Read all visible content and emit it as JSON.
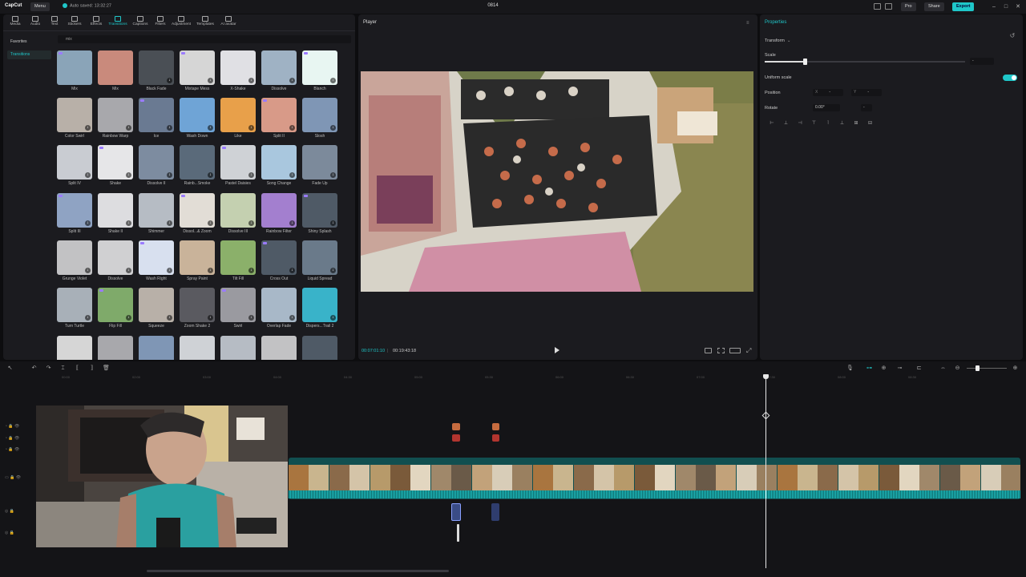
{
  "app": {
    "logo": "CapCut",
    "menu_label": "Menu",
    "autosave": "Auto saved: 13:32:27",
    "project_title": "0814",
    "pro_label": "Pro",
    "share_label": "Share",
    "export_label": "Export"
  },
  "tabs": [
    "Media",
    "Audio",
    "Text",
    "Stickers",
    "Effects",
    "Transitions",
    "Captions",
    "Filters",
    "Adjustment",
    "Templates",
    "AI avatar"
  ],
  "categories": [
    "Favorites",
    "Transitions"
  ],
  "search_value": "mix",
  "transitions": [
    [
      "Mix",
      "Mix",
      "Black Fade",
      "Mixtape Mess",
      "X-Shake",
      "Dissolve",
      "Blanch"
    ],
    [
      "Color Swirl",
      "Rainbow Warp",
      "Ice",
      "Wash Down",
      "Like",
      "Split II",
      "Slosh"
    ],
    [
      "Split IV",
      "Shake",
      "Dissolve II",
      "Rainb...Smoke",
      "Pastel Daisies",
      "Song Change",
      "Fade Up"
    ],
    [
      "Split III",
      "Shake II",
      "Shimmer",
      "Dissol...& Zoom",
      "Dissolve III",
      "Rainbow Filter",
      "Shiny Splash"
    ],
    [
      "Grunge Violet",
      "Dissolve",
      "Wash Right",
      "Spray Paint",
      "Tilt Fill",
      "Cross Out",
      "Liquid Spread"
    ],
    [
      "Turn Turtle",
      "Flip Fill",
      "Squeeze",
      "Zoom Shake 2",
      "Swirl",
      "Overlap Fade",
      "Dispers...Trail 2"
    ]
  ],
  "player": {
    "title": "Player",
    "time_current": "00:07:01:10",
    "time_total": "00:19:43:18"
  },
  "properties": {
    "title": "Properties",
    "transform_label": "Transform",
    "scale_label": "Scale",
    "scale_value": "-",
    "scale_fraction": 0.2,
    "uniform_scale_label": "Uniform scale",
    "uniform_scale_on": true,
    "position_label": "Position",
    "position_x_label": "X",
    "position_x": "-",
    "position_y_label": "Y",
    "position_y": "-",
    "rotate_label": "Rotate",
    "rotate_value": "0.00°",
    "rotate_extra": "-"
  },
  "timeline": {
    "ruler_ticks": [
      "00:00",
      "02:00",
      "03:00",
      "04:00",
      "04:30",
      "05:00",
      "05:30",
      "06:00",
      "06:30",
      "07:00",
      "07:30",
      "08:00",
      "08:30"
    ],
    "playhead_fraction": 0.735
  },
  "colors": {
    "accent": "#1fc7c9",
    "panel": "#1b1b1f",
    "background": "#0d0d0f"
  }
}
